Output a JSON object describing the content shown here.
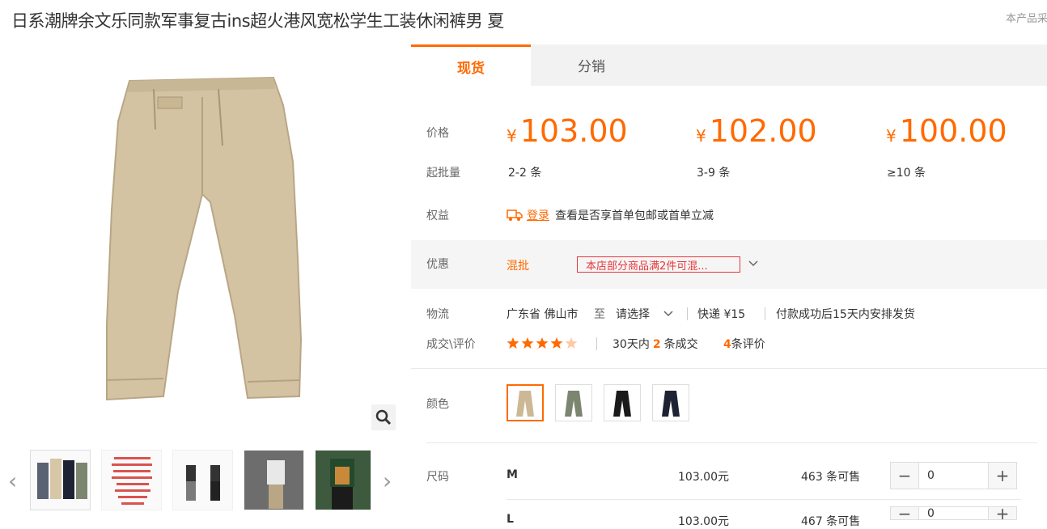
{
  "product": {
    "title": "日系潮牌余文乐同款军事复古ins超火港风宽松学生工装休闲裤男 夏",
    "notice": "本产品采"
  },
  "tabs": [
    {
      "label": "现货"
    },
    {
      "label": "分销"
    }
  ],
  "price_section": {
    "price_label": "价格",
    "moq_label": "起批量",
    "currency": "¥",
    "tiers": [
      {
        "price": "103.00",
        "qty": "2-2 条"
      },
      {
        "price": "102.00",
        "qty": "3-9 条"
      },
      {
        "price": "100.00",
        "qty": "≥10 条"
      }
    ]
  },
  "benefits": {
    "label": "权益",
    "login": "登录",
    "text": "查看是否享首单包邮或首单立减"
  },
  "promo": {
    "label": "优惠",
    "type": "混批",
    "text": "本店部分商品满2件可混..."
  },
  "logistics": {
    "label": "物流",
    "from": "广东省 佛山市",
    "to_label": "至",
    "to_select": "请选择",
    "fee": "快递 ¥15",
    "delivery": "付款成功后15天内安排发货"
  },
  "deals": {
    "label": "成交\\评价",
    "rating": 4.5,
    "sales_prefix": "30天内",
    "sales_count": "2",
    "sales_suffix": "条成交",
    "review_count": "4",
    "review_suffix": "条评价"
  },
  "colors": {
    "label": "颜色",
    "options": [
      {
        "name": "khaki",
        "color": "#cdb896"
      },
      {
        "name": "olive",
        "color": "#7c8570"
      },
      {
        "name": "black",
        "color": "#1b1b1b"
      },
      {
        "name": "navy",
        "color": "#1e2333"
      }
    ]
  },
  "sizes": {
    "label": "尺码",
    "rows": [
      {
        "size": "M",
        "price": "103.00元",
        "stock": "463 条可售",
        "qty": "0"
      },
      {
        "size": "L",
        "price": "103.00元",
        "stock": "467 条可售",
        "qty": "0"
      }
    ]
  },
  "colors_theme": {
    "accent": "#ff6a00",
    "promo_red": "#e4393c"
  }
}
